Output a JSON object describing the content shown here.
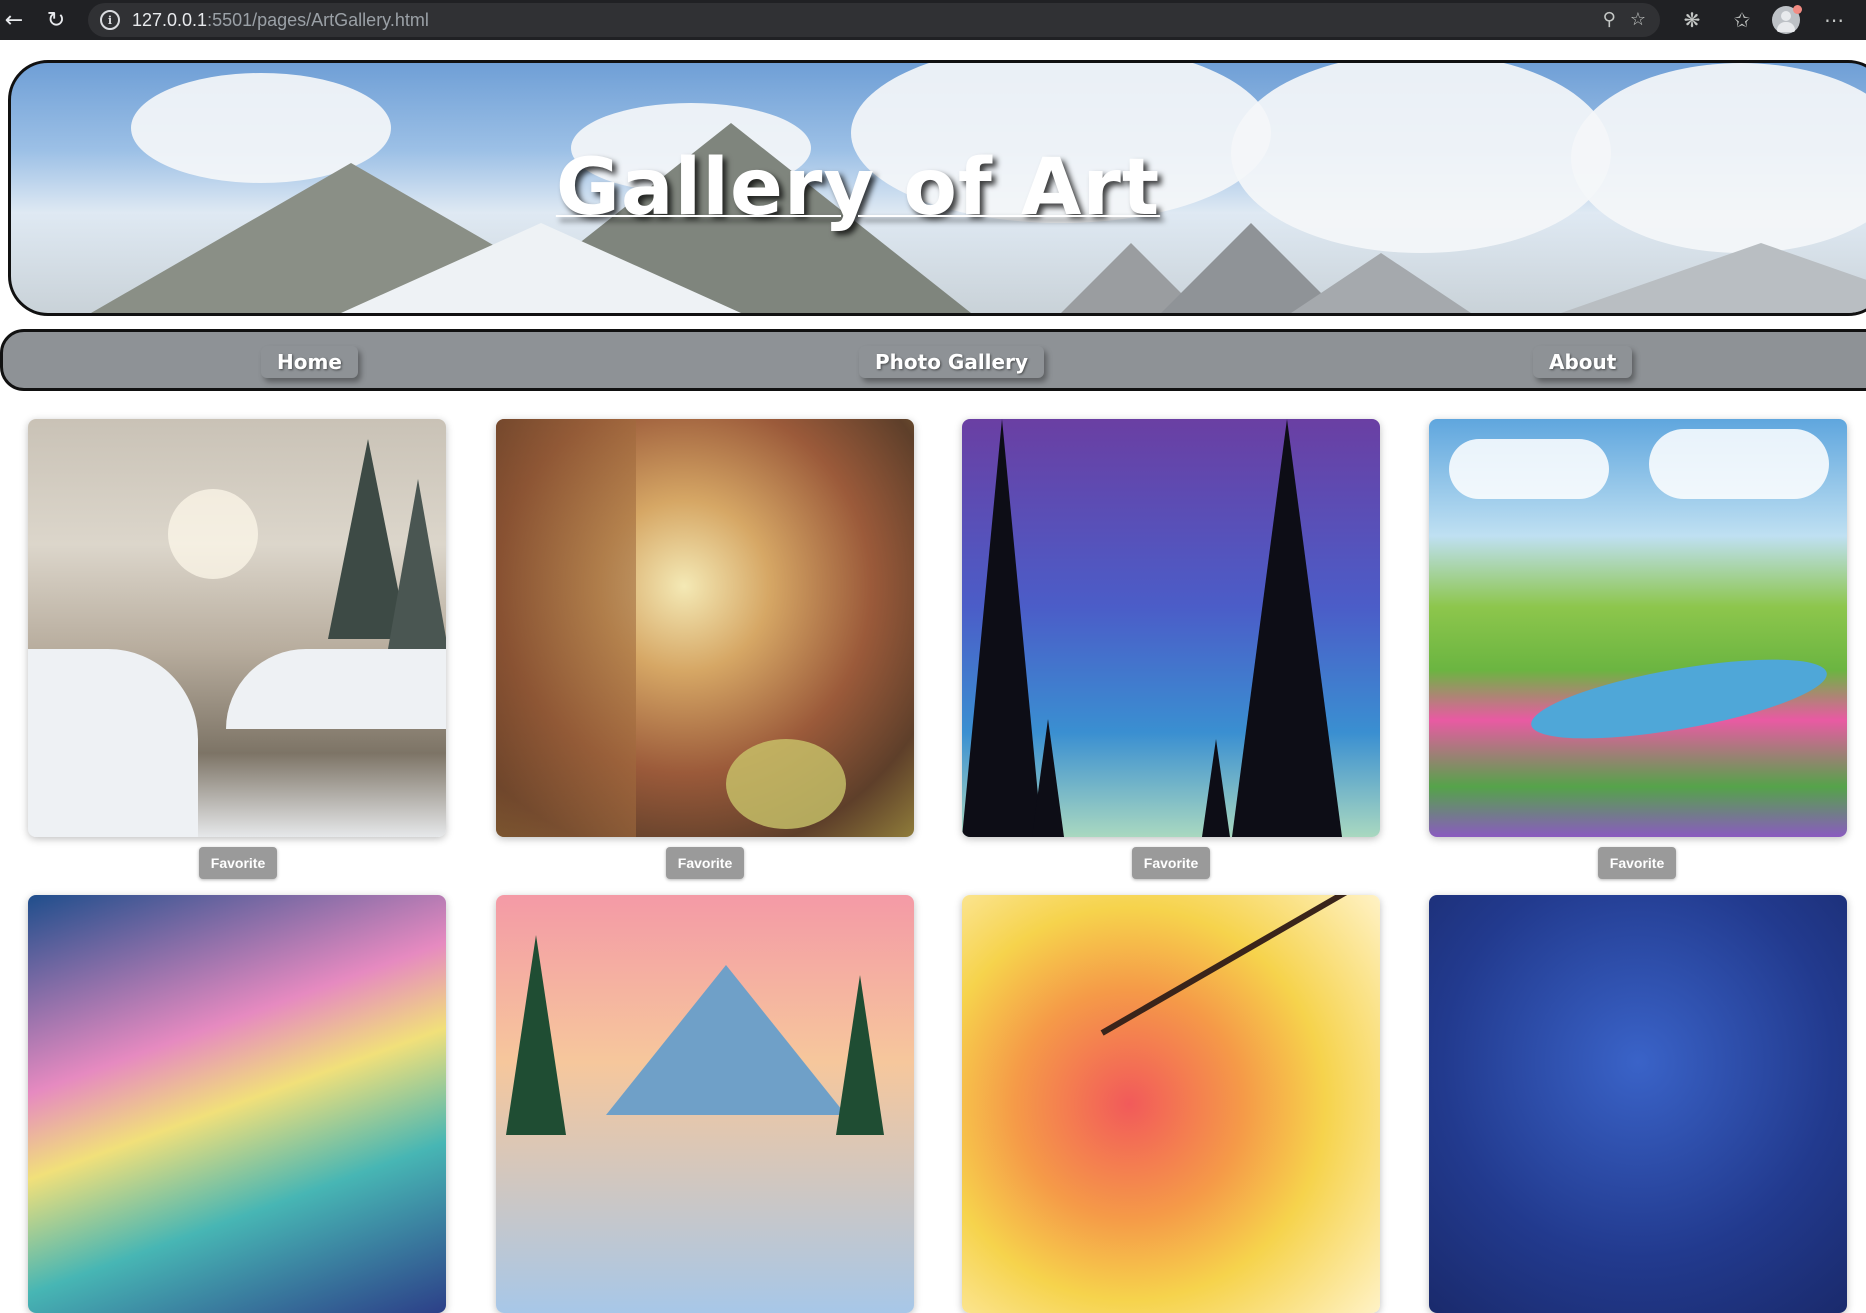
{
  "browser": {
    "url_host": "127.0.0.1",
    "url_rest": ":5501/pages/ArtGallery.html"
  },
  "banner": {
    "title": "Gallery of Art"
  },
  "nav": {
    "items": [
      {
        "label": "Home"
      },
      {
        "label": "Photo Gallery"
      },
      {
        "label": "About"
      }
    ]
  },
  "gallery": {
    "favorite_label": "Favorite",
    "items": [
      {
        "subject": "snowy river at sunrise"
      },
      {
        "subject": "autumn forest"
      },
      {
        "subject": "starry night with pine silhouettes"
      },
      {
        "subject": "meadow with river and flowers"
      },
      {
        "subject": "watercolor aurora"
      },
      {
        "subject": "mountain at sunset"
      },
      {
        "subject": "red blossom tree"
      },
      {
        "subject": "starry galaxy sky"
      }
    ]
  },
  "colors": {
    "nav_bg": "#8e9296",
    "favorite_bg": "#9a9a9a",
    "chrome_bg": "#202124"
  }
}
